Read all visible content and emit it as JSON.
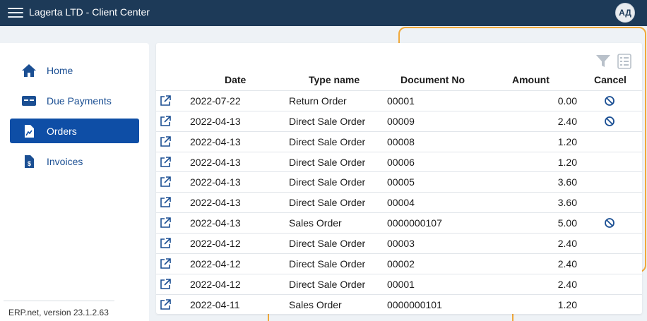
{
  "header": {
    "app_title": "Lagerta LTD - Client Center",
    "avatar_initials": "АД",
    "menu_icon": "hamburger-icon"
  },
  "sidebar": {
    "items": [
      {
        "label": "Home",
        "icon": "home-icon",
        "active": false
      },
      {
        "label": "Due Payments",
        "icon": "credit-card-icon",
        "active": false
      },
      {
        "label": "Orders",
        "icon": "document-chart-icon",
        "active": true
      },
      {
        "label": "Invoices",
        "icon": "invoice-dollar-icon",
        "active": false
      }
    ],
    "version": "ERP.net, version 23.1.2.63"
  },
  "table": {
    "toolbar": {
      "filter_icon": "filter-icon",
      "columns_icon": "column-chooser-icon"
    },
    "columns": [
      "Date",
      "Type name",
      "Document No",
      "Amount",
      "Cancel"
    ],
    "rows": [
      {
        "date": "2022-07-22",
        "type": "Return Order",
        "doc": "00001",
        "amount": "0.00",
        "cancel": true
      },
      {
        "date": "2022-04-13",
        "type": "Direct Sale Order",
        "doc": "00009",
        "amount": "2.40",
        "cancel": true
      },
      {
        "date": "2022-04-13",
        "type": "Direct Sale Order",
        "doc": "00008",
        "amount": "1.20",
        "cancel": false
      },
      {
        "date": "2022-04-13",
        "type": "Direct Sale Order",
        "doc": "00006",
        "amount": "1.20",
        "cancel": false
      },
      {
        "date": "2022-04-13",
        "type": "Direct Sale Order",
        "doc": "00005",
        "amount": "3.60",
        "cancel": false
      },
      {
        "date": "2022-04-13",
        "type": "Direct Sale Order",
        "doc": "00004",
        "amount": "3.60",
        "cancel": false
      },
      {
        "date": "2022-04-13",
        "type": "Sales Order",
        "doc": "0000000107",
        "amount": "5.00",
        "cancel": true
      },
      {
        "date": "2022-04-12",
        "type": "Direct Sale Order",
        "doc": "00003",
        "amount": "2.40",
        "cancel": false
      },
      {
        "date": "2022-04-12",
        "type": "Direct Sale Order",
        "doc": "00002",
        "amount": "2.40",
        "cancel": false
      },
      {
        "date": "2022-04-12",
        "type": "Direct Sale Order",
        "doc": "00001",
        "amount": "2.40",
        "cancel": false
      },
      {
        "date": "2022-04-11",
        "type": "Sales Order",
        "doc": "0000000101",
        "amount": "1.20",
        "cancel": false
      }
    ]
  },
  "colors": {
    "topbar": "#1d3a58",
    "accent": "#0e4ea6",
    "link": "#1b4f93",
    "highlight": "#f0a93b"
  }
}
